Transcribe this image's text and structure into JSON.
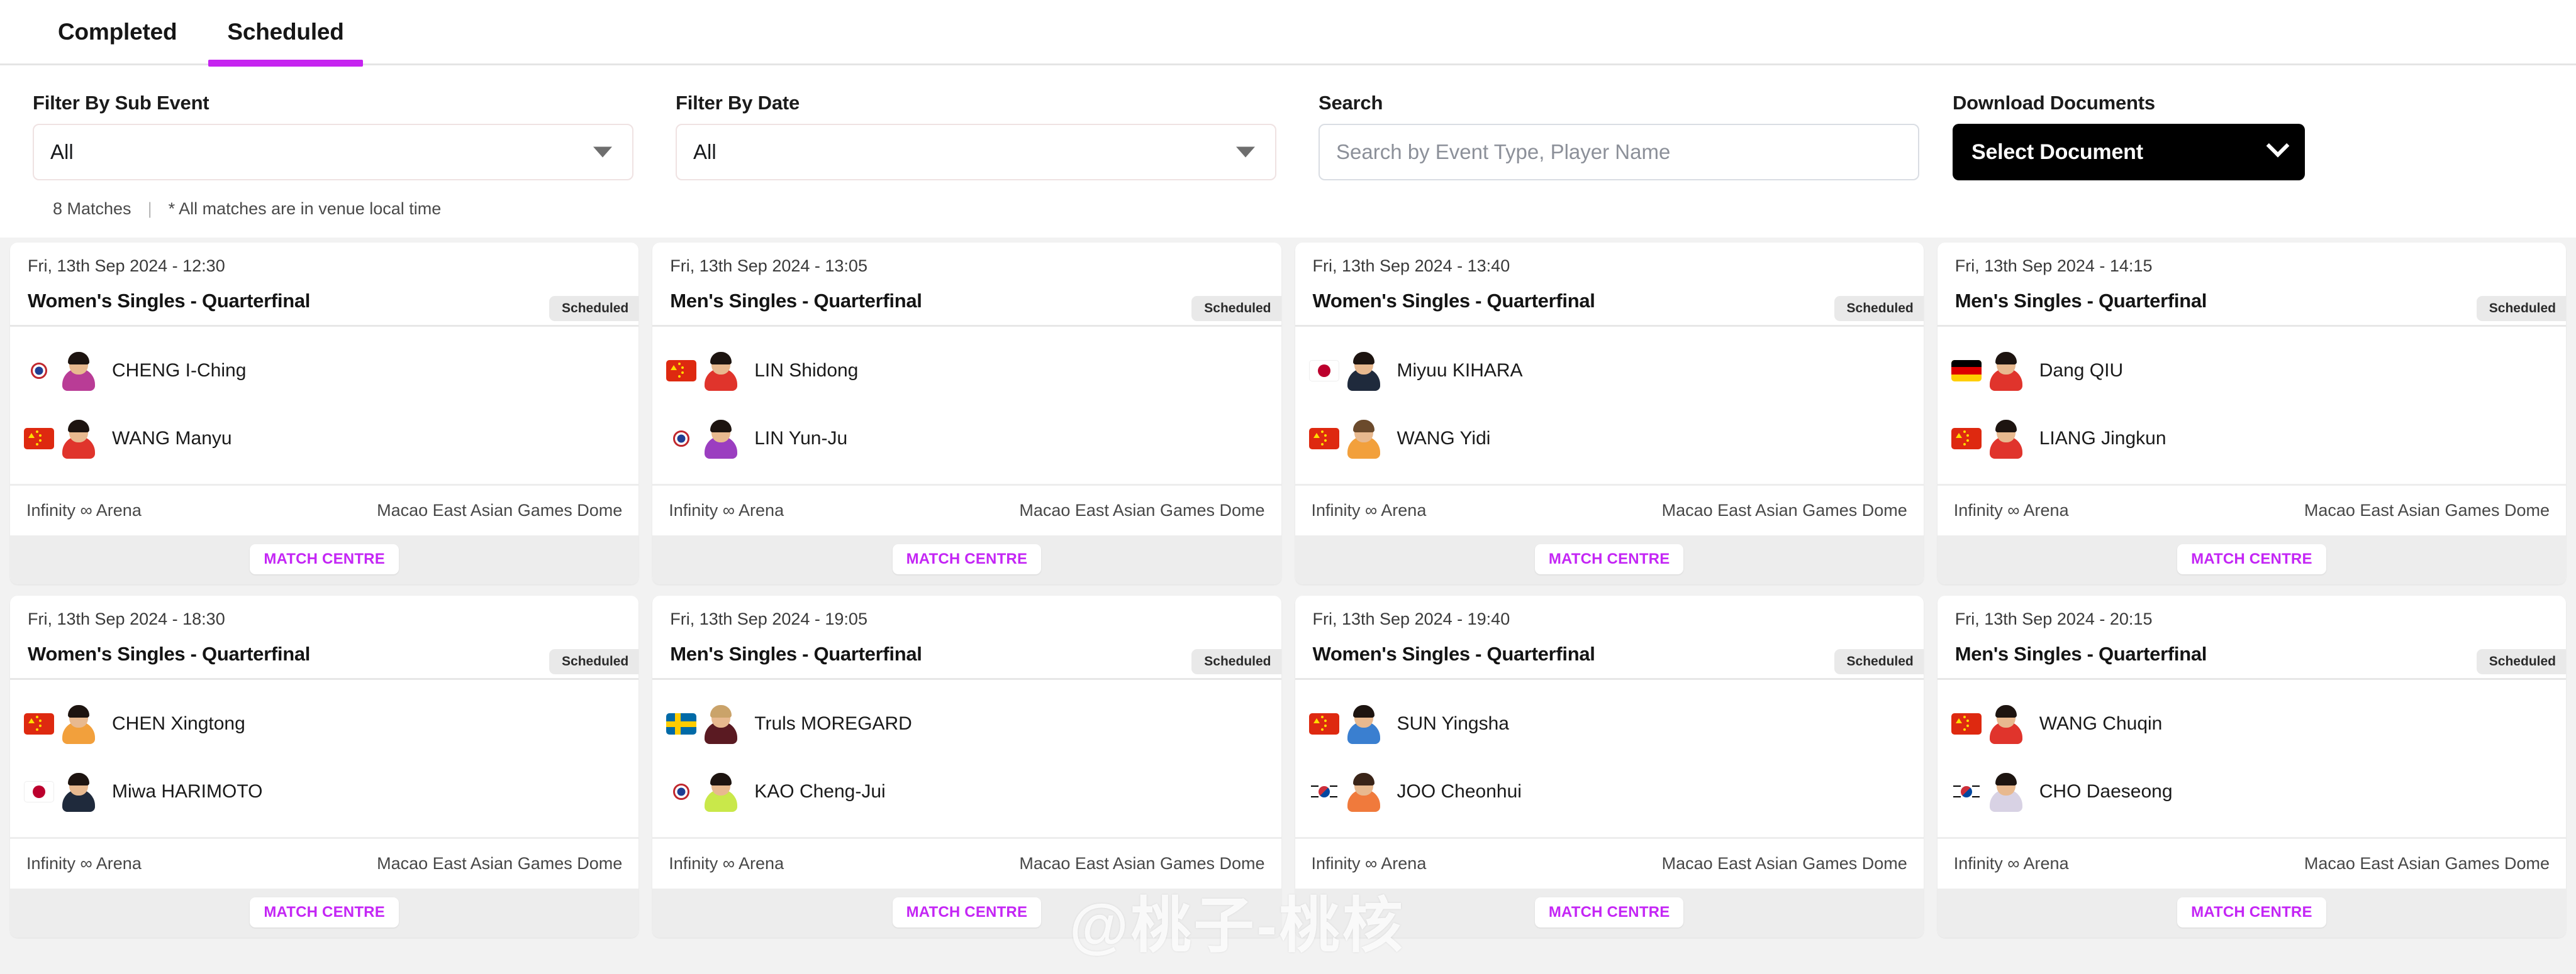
{
  "tabs": [
    {
      "label": "Completed",
      "active": false
    },
    {
      "label": "Scheduled",
      "active": true
    }
  ],
  "filters": {
    "sub_event": {
      "label": "Filter By Sub Event",
      "value": "All"
    },
    "date": {
      "label": "Filter By Date",
      "value": "All"
    },
    "search": {
      "label": "Search",
      "placeholder": "Search by Event Type, Player Name",
      "value": ""
    },
    "download": {
      "label": "Download Documents",
      "value": "Select Document"
    }
  },
  "summary": {
    "match_count": "8 Matches",
    "separator": "|",
    "note": "* All matches are in venue local time"
  },
  "match_centre_label": "MATCH CENTRE",
  "colors": {
    "accent": "#c624f0",
    "match_centre": "#c426f5",
    "page_bg": "#f2f2f2",
    "badge_bg": "#e9e9e9",
    "download_bg": "#000000"
  },
  "matches": [
    {
      "datetime": "Fri, 13th Sep 2024 - 12:30",
      "event": "Women's Singles - Quarterfinal",
      "status": "Scheduled",
      "venue_table": "Infinity ∞ Arena",
      "venue_name": "Macao East Asian Games Dome",
      "players": [
        {
          "name": "CHENG I-Ching",
          "flag": "tpe",
          "kit": "#b93c96",
          "hair": "#1d1410"
        },
        {
          "name": "WANG Manyu",
          "flag": "cn",
          "kit": "#e0342c",
          "hair": "#1d1410"
        }
      ]
    },
    {
      "datetime": "Fri, 13th Sep 2024 - 13:05",
      "event": "Men's Singles - Quarterfinal",
      "status": "Scheduled",
      "venue_table": "Infinity ∞ Arena",
      "venue_name": "Macao East Asian Games Dome",
      "players": [
        {
          "name": "LIN Shidong",
          "flag": "cn",
          "kit": "#e0342c",
          "hair": "#1d1410"
        },
        {
          "name": "LIN Yun-Ju",
          "flag": "tpe",
          "kit": "#9b3ec0",
          "hair": "#1d1410"
        }
      ]
    },
    {
      "datetime": "Fri, 13th Sep 2024 - 13:40",
      "event": "Women's Singles - Quarterfinal",
      "status": "Scheduled",
      "venue_table": "Infinity ∞ Arena",
      "venue_name": "Macao East Asian Games Dome",
      "players": [
        {
          "name": "Miyuu KIHARA",
          "flag": "jp",
          "kit": "#1f2a3c",
          "hair": "#1d1410"
        },
        {
          "name": "WANG Yidi",
          "flag": "cn",
          "kit": "#f2a03c",
          "hair": "#6b4a2c"
        }
      ]
    },
    {
      "datetime": "Fri, 13th Sep 2024 - 14:15",
      "event": "Men's Singles - Quarterfinal",
      "status": "Scheduled",
      "venue_table": "Infinity ∞ Arena",
      "venue_name": "Macao East Asian Games Dome",
      "players": [
        {
          "name": "Dang QIU",
          "flag": "de",
          "kit": "#e0342c",
          "hair": "#1d1410"
        },
        {
          "name": "LIANG Jingkun",
          "flag": "cn",
          "kit": "#e0342c",
          "hair": "#1d1410"
        }
      ]
    },
    {
      "datetime": "Fri, 13th Sep 2024 - 18:30",
      "event": "Women's Singles - Quarterfinal",
      "status": "Scheduled",
      "venue_table": "Infinity ∞ Arena",
      "venue_name": "Macao East Asian Games Dome",
      "players": [
        {
          "name": "CHEN Xingtong",
          "flag": "cn",
          "kit": "#f2a03c",
          "hair": "#1d1410"
        },
        {
          "name": "Miwa HARIMOTO",
          "flag": "jp",
          "kit": "#1f2a3c",
          "hair": "#1d1410"
        }
      ]
    },
    {
      "datetime": "Fri, 13th Sep 2024 - 19:05",
      "event": "Men's Singles - Quarterfinal",
      "status": "Scheduled",
      "venue_table": "Infinity ∞ Arena",
      "venue_name": "Macao East Asian Games Dome",
      "players": [
        {
          "name": "Truls MOREGARD",
          "flag": "se",
          "kit": "#5a1a22",
          "hair": "#caa36a"
        },
        {
          "name": "KAO Cheng-Jui",
          "flag": "tpe",
          "kit": "#c9e84a",
          "hair": "#1d1410"
        }
      ]
    },
    {
      "datetime": "Fri, 13th Sep 2024 - 19:40",
      "event": "Women's Singles - Quarterfinal",
      "status": "Scheduled",
      "venue_table": "Infinity ∞ Arena",
      "venue_name": "Macao East Asian Games Dome",
      "players": [
        {
          "name": "SUN Yingsha",
          "flag": "cn",
          "kit": "#3a7fd0",
          "hair": "#1d1410"
        },
        {
          "name": "JOO Cheonhui",
          "flag": "kr",
          "kit": "#f07a3c",
          "hair": "#3a2418"
        }
      ]
    },
    {
      "datetime": "Fri, 13th Sep 2024 - 20:15",
      "event": "Men's Singles - Quarterfinal",
      "status": "Scheduled",
      "venue_table": "Infinity ∞ Arena",
      "venue_name": "Macao East Asian Games Dome",
      "players": [
        {
          "name": "WANG Chuqin",
          "flag": "cn",
          "kit": "#e0342c",
          "hair": "#1d1410"
        },
        {
          "name": "CHO Daeseong",
          "flag": "kr",
          "kit": "#d8d2e4",
          "hair": "#1d1410"
        }
      ]
    }
  ],
  "watermark": "@桃子-桃核"
}
